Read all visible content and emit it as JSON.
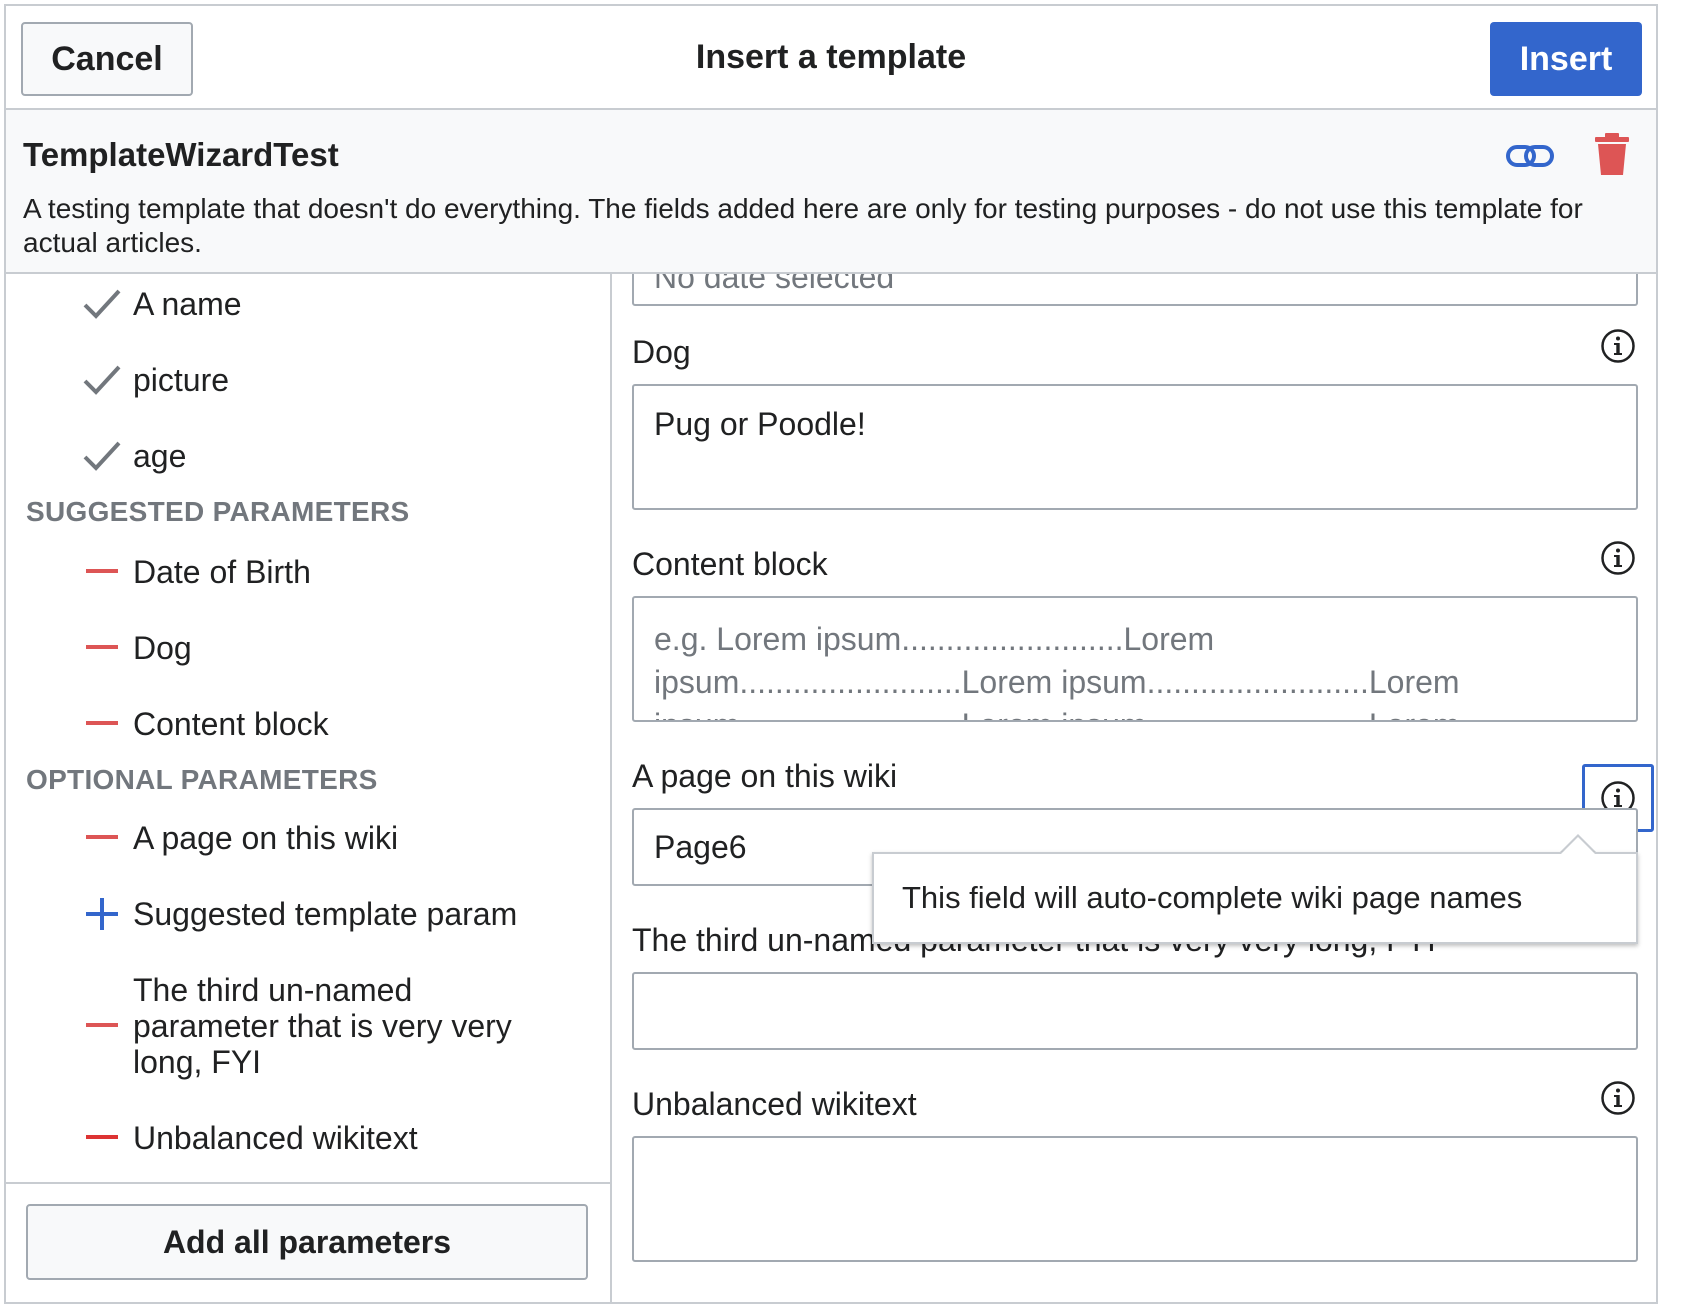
{
  "dialog": {
    "title": "Insert a template",
    "cancel_label": "Cancel",
    "insert_label": "Insert",
    "accent_color": "#3366cc",
    "destructive_color": "#d33"
  },
  "template": {
    "name": "TemplateWizardTest",
    "description": "A testing template that doesn't do everything. The fields added here are only for testing purposes - do not use this template for actual articles.",
    "link_icon": "link-icon",
    "remove_icon": "trash-icon"
  },
  "sidebar": {
    "required_items": [
      {
        "label": "A name",
        "icon": "check-icon"
      },
      {
        "label": "picture",
        "icon": "check-icon"
      },
      {
        "label": "age",
        "icon": "check-icon"
      }
    ],
    "suggested_heading": "SUGGESTED PARAMETERS",
    "suggested_items": [
      {
        "label": "Date of Birth",
        "icon": "minus-icon"
      },
      {
        "label": "Dog",
        "icon": "minus-icon"
      },
      {
        "label": "Content block",
        "icon": "minus-icon"
      }
    ],
    "optional_heading": "OPTIONAL PARAMETERS",
    "optional_items": [
      {
        "label": "A page on this wiki",
        "icon": "minus-icon"
      },
      {
        "label": "Suggested template param",
        "icon": "plus-icon"
      },
      {
        "label": "The third un-named parameter that is very very long, FYI",
        "icon": "minus-icon"
      },
      {
        "label": "Unbalanced wikitext",
        "icon": "minus-icon"
      }
    ],
    "add_all_label": "Add all parameters"
  },
  "main": {
    "date_field": {
      "placeholder": "No date selected"
    },
    "dog_field": {
      "label": "Dog",
      "value": "Pug or Poodle!"
    },
    "content_block_field": {
      "label": "Content block",
      "placeholder_line1": "e.g. Lorem ipsum.........................Lorem",
      "placeholder_line2": "ipsum.........................Lorem ipsum.........................Lorem",
      "placeholder_line3": "ipsum.........................Lorem ipsum.........................Lorem"
    },
    "page_field": {
      "label": "A page on this wiki",
      "value": "Page6"
    },
    "tooltip": "This field will auto-complete wiki page names",
    "third_field": {
      "label": "The third un-named parameter that is very very long, FYI",
      "value": ""
    },
    "unbalanced_field": {
      "label": "Unbalanced wikitext",
      "value": ""
    }
  }
}
